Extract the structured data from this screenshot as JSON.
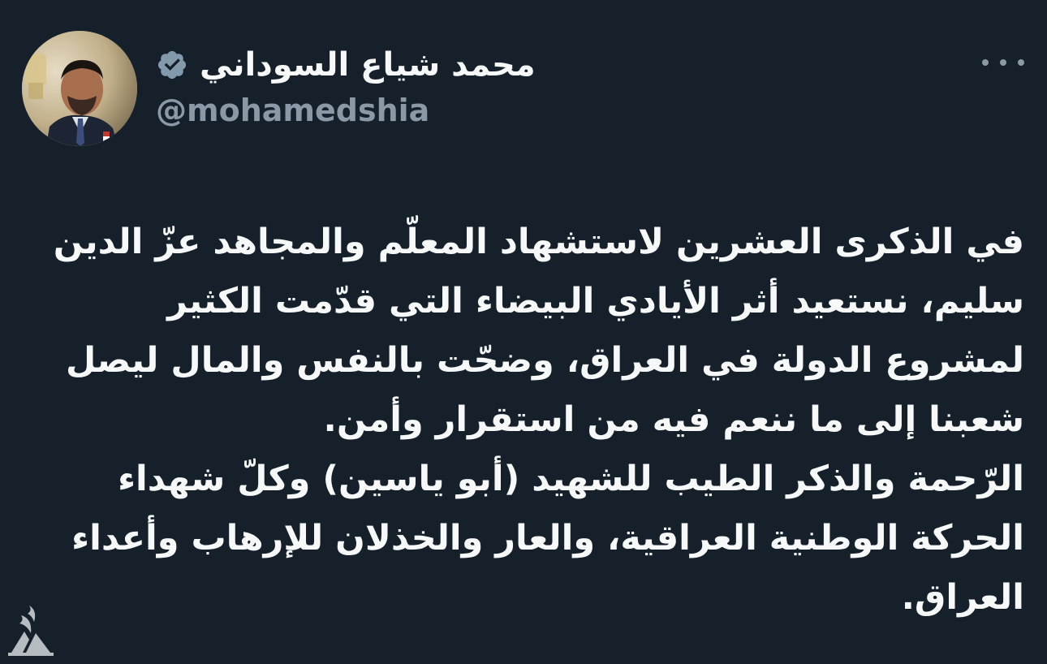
{
  "author": {
    "display_name": "محمد شياع السوداني",
    "handle": "@mohamedshia",
    "verified": true
  },
  "tweet": {
    "paragraphs": [
      "في الذكرى العشرين لاستشهاد المعلّم والمجاهد عزّ الدين سليم، نستعيد أثر الأيادي البيضاء التي قدّمت الكثير لمشروع الدولة في العراق، وضحّت بالنفس والمال ليصل شعبنا إلى ما ننعم فيه من استقرار وأمن.",
      "الرّحمة والذكر الطيب للشهيد (أبو ياسين) وكلّ شهداء الحركة الوطنية العراقية، والعار والخذلان للإرهاب وأعداء العراق."
    ]
  },
  "icons": {
    "verified": "verified-badge-icon",
    "more": "more-options-icon",
    "watermark": "channel-logo-watermark"
  },
  "colors": {
    "background": "#15202b",
    "text_primary": "#f7f9f9",
    "text_secondary": "#8b98a5",
    "verified_badge": "#829aab"
  }
}
